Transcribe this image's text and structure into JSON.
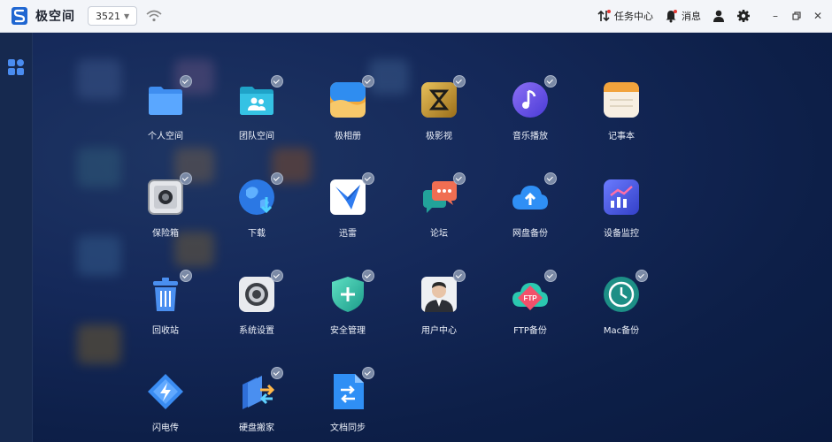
{
  "titlebar": {
    "app_title": "极空间",
    "device_label": "3521",
    "task_center": "任务中心",
    "messages": "消息"
  },
  "apps": [
    {
      "label": "个人空间",
      "icon": "folder-icon"
    },
    {
      "label": "团队空间",
      "icon": "team-folder-icon"
    },
    {
      "label": "极相册",
      "icon": "photo-album-icon"
    },
    {
      "label": "极影视",
      "icon": "video-icon"
    },
    {
      "label": "音乐播放",
      "icon": "music-icon"
    },
    {
      "label": "记事本",
      "icon": "notepad-icon"
    },
    {
      "label": "保险箱",
      "icon": "safe-icon"
    },
    {
      "label": "下载",
      "icon": "download-icon"
    },
    {
      "label": "迅雷",
      "icon": "thunder-icon"
    },
    {
      "label": "论坛",
      "icon": "forum-icon"
    },
    {
      "label": "网盘备份",
      "icon": "cloud-backup-icon"
    },
    {
      "label": "设备监控",
      "icon": "monitor-icon"
    },
    {
      "label": "回收站",
      "icon": "trash-icon"
    },
    {
      "label": "系统设置",
      "icon": "settings-icon"
    },
    {
      "label": "安全管理",
      "icon": "shield-icon"
    },
    {
      "label": "用户中心",
      "icon": "user-center-icon"
    },
    {
      "label": "FTP备份",
      "icon": "ftp-icon"
    },
    {
      "label": "Mac备份",
      "icon": "time-machine-icon"
    },
    {
      "label": "闪电传",
      "icon": "flash-transfer-icon"
    },
    {
      "label": "硬盘搬家",
      "icon": "disk-move-icon"
    },
    {
      "label": "文档同步",
      "icon": "doc-sync-icon"
    }
  ]
}
